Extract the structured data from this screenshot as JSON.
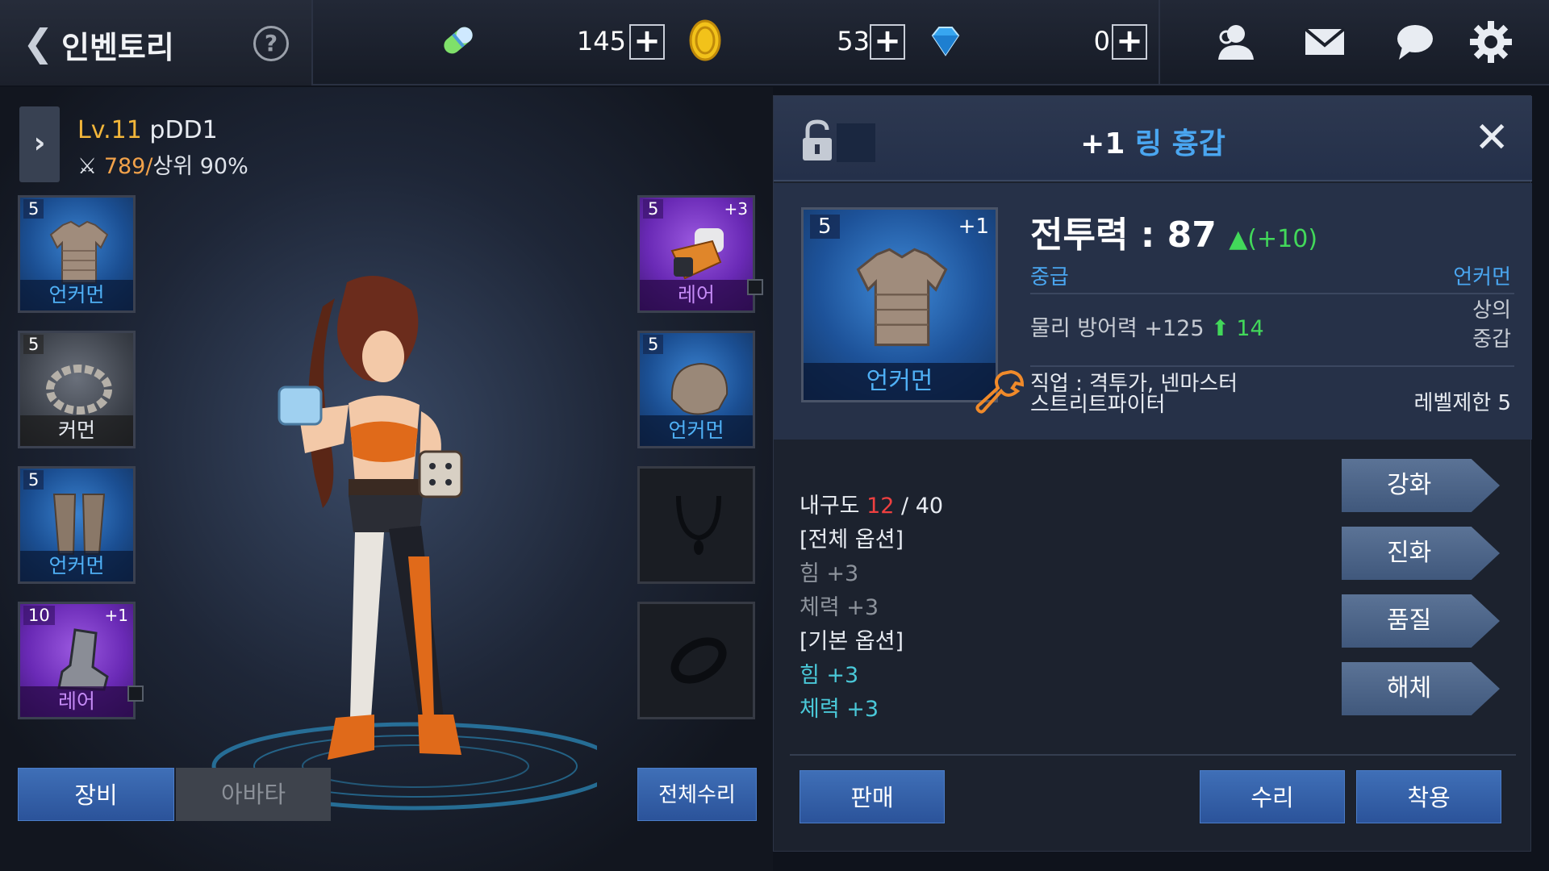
{
  "header": {
    "title": "인벤토리",
    "help_label": "?",
    "resources": [
      {
        "icon": "stamina-capsule-icon",
        "value": "145"
      },
      {
        "icon": "gold-coin-icon",
        "value": "53"
      },
      {
        "icon": "blue-gem-icon",
        "value": "0"
      }
    ],
    "plus_label": "+"
  },
  "character": {
    "level_prefix": "Lv.11",
    "name": "pDD1",
    "power": "789/",
    "rank": "상위 90%",
    "expand_label": "›"
  },
  "equip_slots": {
    "chest": {
      "level": "5",
      "grade": "언커먼"
    },
    "ring": {
      "level": "5",
      "grade": "커먼"
    },
    "legs": {
      "level": "5",
      "grade": "언커먼"
    },
    "boots": {
      "level": "10",
      "plus": "+1",
      "grade": "레어"
    },
    "gloves": {
      "level": "5",
      "plus": "+3",
      "grade": "레어"
    },
    "helmet": {
      "level": "5",
      "grade": "언커먼"
    }
  },
  "left_buttons": {
    "equip": "장비",
    "avatar": "아바타",
    "repair_all": "전체수리"
  },
  "item": {
    "plus": "+1",
    "name": "링 흉갑",
    "close_label": "✕",
    "level": "5",
    "grade": "언커먼",
    "combat_label": "전투력 : 87",
    "combat_delta": "▲(+10)",
    "tier": "중급",
    "rarity": "언커먼",
    "defense": "물리 방어력 +125",
    "defense_up": "14",
    "slot_type_1": "상의",
    "slot_type_2": "중갑",
    "job_line1": "직업 : 격투가, 넨마스터",
    "job_line2": "스트리트파이터",
    "level_limit": "레벨제한 5",
    "durability_label": "내구도 ",
    "durability_cur": "12",
    "durability_max": " / 40",
    "all_options_header": "[전체 옵션]",
    "all_opt_1": "힘 +3",
    "all_opt_2": "체력 +3",
    "base_options_header": "[기본 옵션]",
    "base_opt_1": "힘 +3",
    "base_opt_2": "체력 +3"
  },
  "actions": {
    "enhance": "강화",
    "evolve": "진화",
    "quality": "품질",
    "dismantle": "해체",
    "sell": "판매",
    "repair": "수리",
    "equip": "착용"
  },
  "colors": {
    "uncommon": "#4fb0f5",
    "rare": "#c48af5",
    "level_gold": "#f2b63a",
    "positive_green": "#42d85a",
    "durability_red": "#ef4040"
  }
}
